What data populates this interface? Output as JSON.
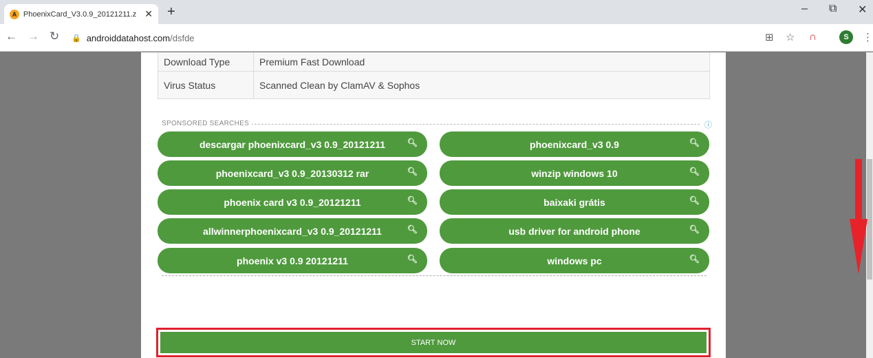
{
  "browser": {
    "tab_title": "PhoenixCard_V3.0.9_20121211.z",
    "favicon_letter": "A",
    "url_domain": "androiddatahost.com",
    "url_path": "/dsfde",
    "profile_initial": "S"
  },
  "info_table": [
    {
      "key": "Download Type",
      "value": "Premium Fast Download"
    },
    {
      "key": "Virus Status",
      "value": "Scanned Clean by ClamAV & Sophos"
    }
  ],
  "sponsored": {
    "label": "SPONSORED SEARCHES",
    "items": [
      "descargar phoenixcard_v3 0.9_20121211",
      "phoenixcard_v3 0.9",
      "phoenixcard_v3 0.9_20130312 rar",
      "winzip windows 10",
      "phoenix card v3 0.9_20121211",
      "baixaki grátis",
      "allwinnerphoenixcard_v3 0.9_20121211",
      "usb driver for android phone",
      "phoenix v3 0.9 20121211",
      "windows pc"
    ]
  },
  "start_button": {
    "label": "START NOW"
  },
  "colors": {
    "accent_green": "#4f9a3d",
    "highlight_red": "#e0212f"
  }
}
